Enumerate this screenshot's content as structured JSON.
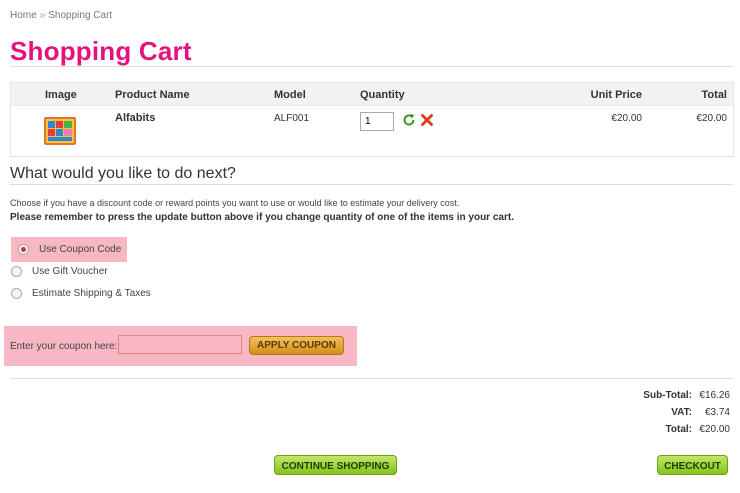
{
  "breadcrumb": {
    "home": "Home",
    "separator": "»",
    "current": "Shopping Cart"
  },
  "page": {
    "title": "Shopping Cart"
  },
  "cart": {
    "columns": {
      "image": "Image",
      "product_name": "Product Name",
      "model": "Model",
      "quantity": "Quantity",
      "unit_price": "Unit Price",
      "total": "Total"
    },
    "items": [
      {
        "name": "Alfabits",
        "model": "ALF001",
        "quantity": "1",
        "unit_price": "€20.00",
        "total": "€20.00"
      }
    ]
  },
  "next": {
    "title": "What would you like to do next?",
    "hint": "Choose if you have a discount code or reward points you want to use or would like to estimate your delivery cost.",
    "hint_bold": "Please remember to press the update button above if you change quantity of one of the items in your cart.",
    "options": [
      {
        "label": "Use Coupon Code",
        "checked": true
      },
      {
        "label": "Use Gift Voucher",
        "checked": false
      },
      {
        "label": "Estimate Shipping & Taxes",
        "checked": false
      }
    ]
  },
  "coupon": {
    "label": "Enter your coupon here:",
    "value": "",
    "apply_label": "APPLY COUPON"
  },
  "totals": {
    "subtotal_label": "Sub-Total:",
    "subtotal": "€16.26",
    "vat_label": "VAT:",
    "vat": "€3.74",
    "total_label": "Total:",
    "total": "€20.00"
  },
  "actions": {
    "continue_label": "CONTINUE SHOPPING",
    "checkout_label": "CHECKOUT"
  },
  "colors": {
    "title_pink": "#e5127d",
    "highlight": "#f7b7c3",
    "apply_orange": "#e0a030",
    "action_green": "#9fd033"
  },
  "icons": {
    "refresh": "refresh-icon",
    "remove": "remove-icon"
  }
}
